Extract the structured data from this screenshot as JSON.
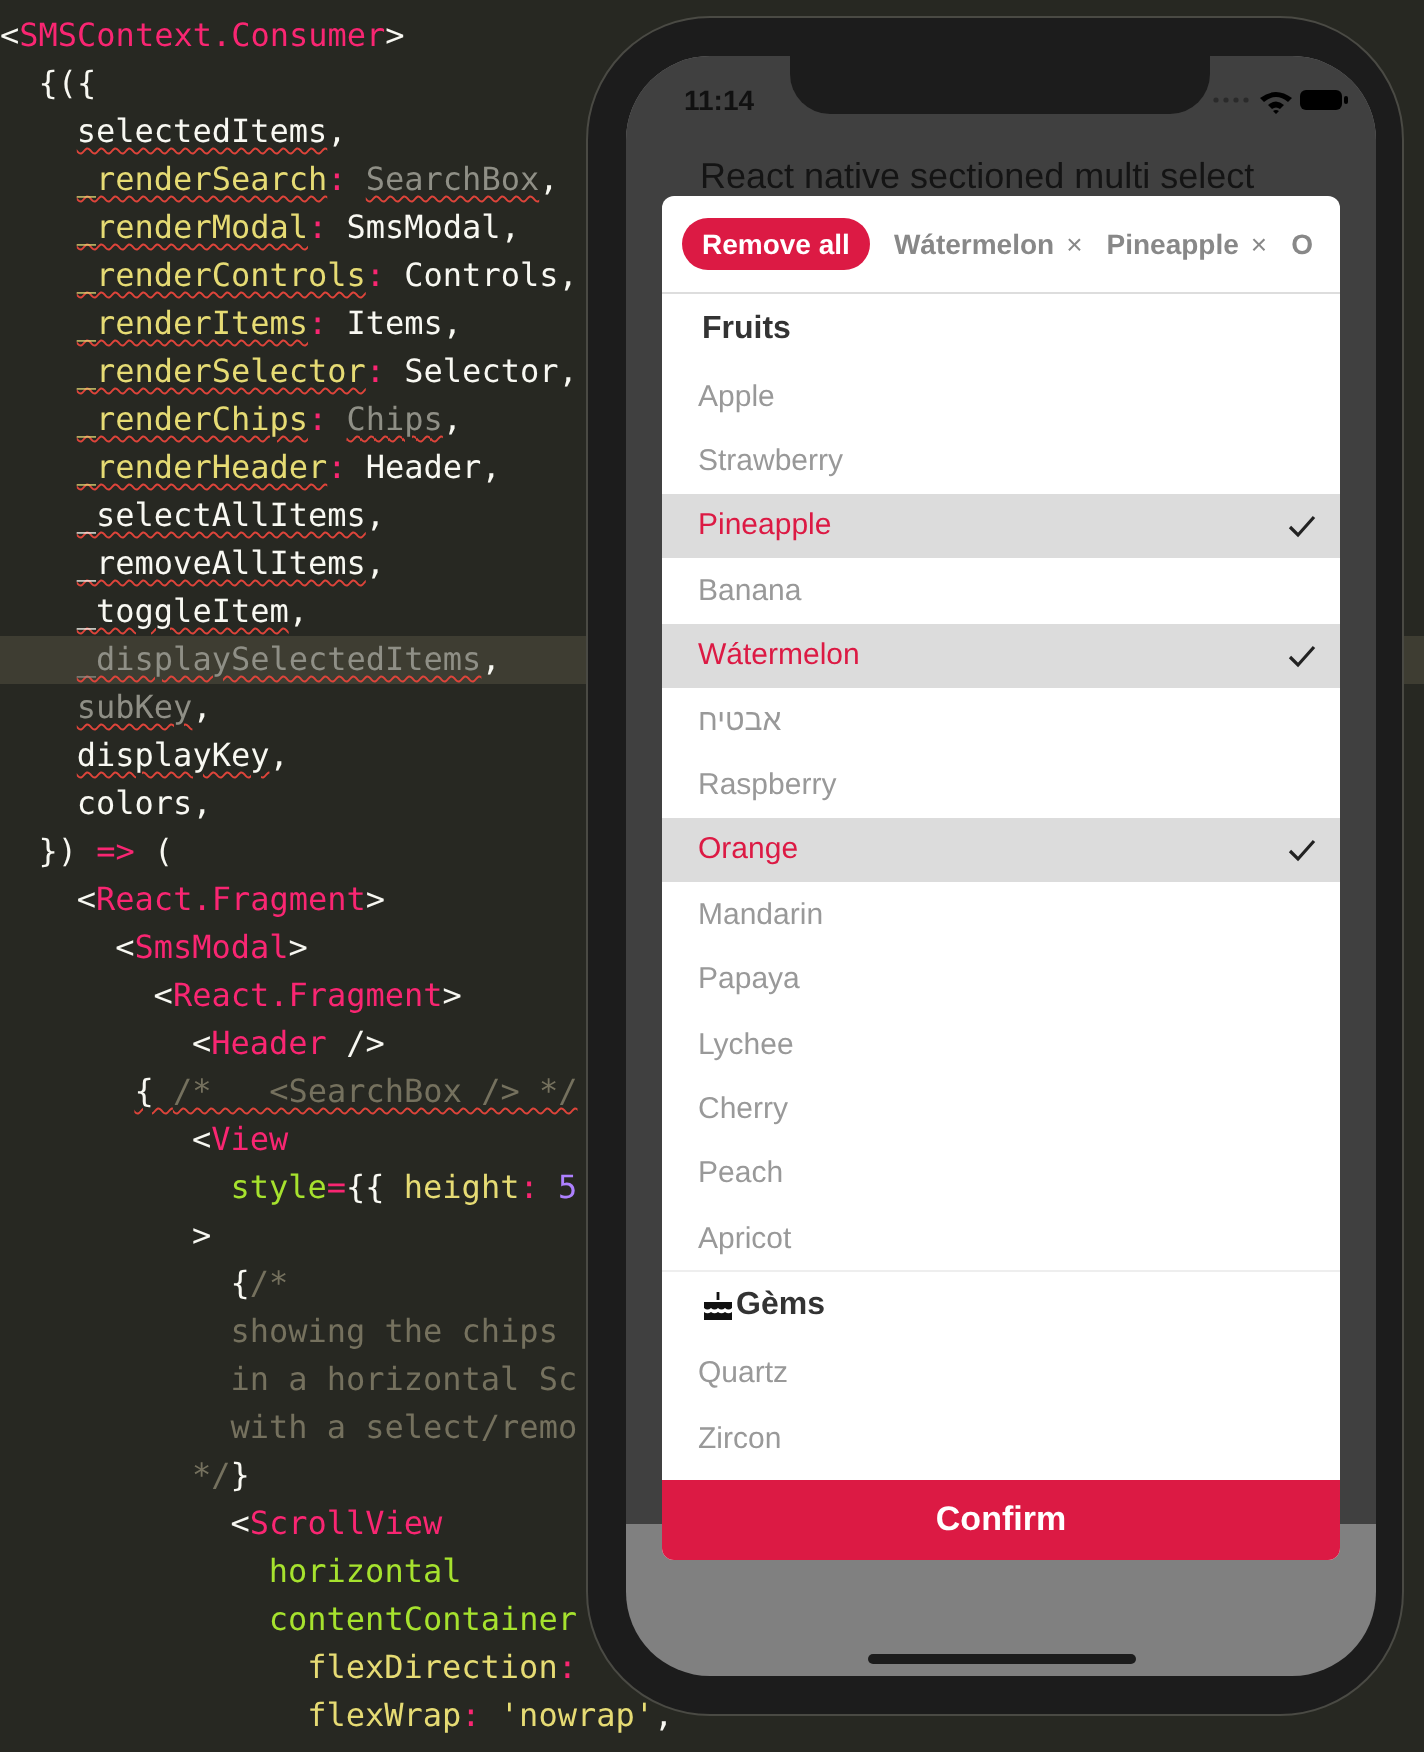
{
  "editor": {
    "lines": [
      {
        "highlighted": false,
        "tokens": [
          {
            "kind": "punct",
            "text": "<",
            "squiggly": false
          },
          {
            "kind": "tag",
            "text": "SMSContext.Consumer",
            "squiggly": false
          },
          {
            "kind": "punct",
            "text": ">",
            "squiggly": false
          }
        ]
      },
      {
        "highlighted": false,
        "tokens": [
          {
            "kind": "punct",
            "text": "{({",
            "squiggly": false
          }
        ]
      },
      {
        "highlighted": false,
        "tokens": [
          {
            "kind": "plain",
            "text": "selectedItems",
            "squiggly": true
          },
          {
            "kind": "punct",
            "text": ",",
            "squiggly": false
          }
        ]
      },
      {
        "highlighted": false,
        "tokens": [
          {
            "kind": "prop",
            "text": "_renderSearch",
            "squiggly": true
          },
          {
            "kind": "operator",
            "text": ": ",
            "squiggly": false
          },
          {
            "kind": "dim",
            "text": "SearchBox",
            "squiggly": true
          },
          {
            "kind": "punct",
            "text": ",",
            "squiggly": false
          }
        ]
      },
      {
        "highlighted": false,
        "tokens": [
          {
            "kind": "prop",
            "text": "_renderModal",
            "squiggly": true
          },
          {
            "kind": "operator",
            "text": ": ",
            "squiggly": false
          },
          {
            "kind": "plain",
            "text": "SmsModal,",
            "squiggly": false
          }
        ]
      },
      {
        "highlighted": false,
        "tokens": [
          {
            "kind": "prop",
            "text": "_renderControls",
            "squiggly": true
          },
          {
            "kind": "operator",
            "text": ": ",
            "squiggly": false
          },
          {
            "kind": "plain",
            "text": "Controls,",
            "squiggly": false
          }
        ]
      },
      {
        "highlighted": false,
        "tokens": [
          {
            "kind": "prop",
            "text": "_renderItems",
            "squiggly": true
          },
          {
            "kind": "operator",
            "text": ": ",
            "squiggly": false
          },
          {
            "kind": "plain",
            "text": "Items,",
            "squiggly": false
          }
        ]
      },
      {
        "highlighted": false,
        "tokens": [
          {
            "kind": "prop",
            "text": "_renderSelector",
            "squiggly": true
          },
          {
            "kind": "operator",
            "text": ": ",
            "squiggly": false
          },
          {
            "kind": "plain",
            "text": "Selector,",
            "squiggly": false
          }
        ]
      },
      {
        "highlighted": false,
        "tokens": [
          {
            "kind": "prop",
            "text": "_renderChips",
            "squiggly": true
          },
          {
            "kind": "operator",
            "text": ": ",
            "squiggly": false
          },
          {
            "kind": "dim",
            "text": "Chips",
            "squiggly": true
          },
          {
            "kind": "punct",
            "text": ",",
            "squiggly": false
          }
        ]
      },
      {
        "highlighted": false,
        "tokens": [
          {
            "kind": "prop",
            "text": "_renderHeader",
            "squiggly": true
          },
          {
            "kind": "operator",
            "text": ": ",
            "squiggly": false
          },
          {
            "kind": "plain",
            "text": "Header,",
            "squiggly": false
          }
        ]
      },
      {
        "highlighted": false,
        "tokens": [
          {
            "kind": "plain",
            "text": "_selectAllItems",
            "squiggly": true
          },
          {
            "kind": "punct",
            "text": ",",
            "squiggly": false
          }
        ]
      },
      {
        "highlighted": false,
        "tokens": [
          {
            "kind": "plain",
            "text": "_removeAllItems",
            "squiggly": true
          },
          {
            "kind": "punct",
            "text": ",",
            "squiggly": false
          }
        ]
      },
      {
        "highlighted": false,
        "tokens": [
          {
            "kind": "plain",
            "text": "_toggleItem",
            "squiggly": true
          },
          {
            "kind": "punct",
            "text": ",",
            "squiggly": false
          }
        ]
      },
      {
        "highlighted": true,
        "tokens": [
          {
            "kind": "dim",
            "text": "_displaySelectedItems",
            "squiggly": true
          },
          {
            "kind": "punct",
            "text": ",",
            "squiggly": false
          }
        ]
      },
      {
        "highlighted": false,
        "tokens": [
          {
            "kind": "dim",
            "text": "subKey",
            "squiggly": true
          },
          {
            "kind": "punct",
            "text": ",",
            "squiggly": false
          }
        ]
      },
      {
        "highlighted": false,
        "tokens": [
          {
            "kind": "plain",
            "text": "displayKey",
            "squiggly": true
          },
          {
            "kind": "punct",
            "text": ",",
            "squiggly": false
          }
        ]
      },
      {
        "highlighted": false,
        "tokens": [
          {
            "kind": "plain",
            "text": "colors,",
            "squiggly": false
          }
        ]
      },
      {
        "highlighted": false,
        "tokens": [
          {
            "kind": "punct",
            "text": "}) ",
            "squiggly": false
          },
          {
            "kind": "operator",
            "text": "=>",
            "squiggly": false
          },
          {
            "kind": "punct",
            "text": " (",
            "squiggly": false
          }
        ]
      },
      {
        "highlighted": false,
        "tokens": [
          {
            "kind": "punct",
            "text": "<",
            "squiggly": false
          },
          {
            "kind": "tag",
            "text": "React.Fragment",
            "squiggly": false
          },
          {
            "kind": "punct",
            "text": ">",
            "squiggly": false
          }
        ]
      },
      {
        "highlighted": false,
        "tokens": [
          {
            "kind": "punct",
            "text": "<",
            "squiggly": false
          },
          {
            "kind": "tag",
            "text": "SmsModal",
            "squiggly": false
          },
          {
            "kind": "punct",
            "text": ">",
            "squiggly": false
          }
        ]
      },
      {
        "highlighted": false,
        "tokens": [
          {
            "kind": "punct",
            "text": "<",
            "squiggly": false
          },
          {
            "kind": "tag",
            "text": "React.Fragment",
            "squiggly": false
          },
          {
            "kind": "punct",
            "text": ">",
            "squiggly": false
          }
        ]
      },
      {
        "highlighted": false,
        "tokens": [
          {
            "kind": "punct",
            "text": "<",
            "squiggly": false
          },
          {
            "kind": "tag",
            "text": "Header",
            "squiggly": false
          },
          {
            "kind": "punct",
            "text": " />",
            "squiggly": false
          }
        ]
      },
      {
        "highlighted": false,
        "tokens": [
          {
            "kind": "punct",
            "text": "{ ",
            "squiggly": true
          },
          {
            "kind": "comment",
            "text": "/*   <SearchBox /> */",
            "squiggly": true
          }
        ]
      },
      {
        "highlighted": false,
        "tokens": [
          {
            "kind": "punct",
            "text": "<",
            "squiggly": false
          },
          {
            "kind": "tag",
            "text": "View",
            "squiggly": false
          }
        ]
      },
      {
        "highlighted": false,
        "tokens": [
          {
            "kind": "attr",
            "text": "style",
            "squiggly": false
          },
          {
            "kind": "operator",
            "text": "=",
            "squiggly": false
          },
          {
            "kind": "punct",
            "text": "{{ ",
            "squiggly": false
          },
          {
            "kind": "prop",
            "text": "height",
            "squiggly": false
          },
          {
            "kind": "operator",
            "text": ": ",
            "squiggly": false
          },
          {
            "kind": "number",
            "text": "5",
            "squiggly": false
          }
        ]
      },
      {
        "highlighted": false,
        "tokens": [
          {
            "kind": "punct",
            "text": ">",
            "squiggly": false
          }
        ]
      },
      {
        "highlighted": false,
        "tokens": [
          {
            "kind": "punct",
            "text": "{",
            "squiggly": false
          },
          {
            "kind": "comment",
            "text": "/*",
            "squiggly": false
          }
        ]
      },
      {
        "highlighted": false,
        "tokens": [
          {
            "kind": "comment",
            "text": "showing the chips",
            "squiggly": false
          }
        ]
      },
      {
        "highlighted": false,
        "tokens": [
          {
            "kind": "comment",
            "text": "in a horizontal Sc",
            "squiggly": false
          }
        ]
      },
      {
        "highlighted": false,
        "tokens": [
          {
            "kind": "comment",
            "text": "with a select/remo",
            "squiggly": false
          }
        ]
      },
      {
        "highlighted": false,
        "tokens": [
          {
            "kind": "comment",
            "text": "*/",
            "squiggly": false
          },
          {
            "kind": "punct",
            "text": "}",
            "squiggly": false
          }
        ]
      },
      {
        "highlighted": false,
        "tokens": [
          {
            "kind": "punct",
            "text": "<",
            "squiggly": false
          },
          {
            "kind": "tag",
            "text": "ScrollView",
            "squiggly": false
          }
        ]
      },
      {
        "highlighted": false,
        "tokens": [
          {
            "kind": "attr",
            "text": "horizontal",
            "squiggly": false
          }
        ]
      },
      {
        "highlighted": false,
        "tokens": [
          {
            "kind": "attr",
            "text": "contentContainer",
            "squiggly": false
          }
        ]
      },
      {
        "highlighted": false,
        "tokens": [
          {
            "kind": "prop",
            "text": "flexDirection",
            "squiggly": false
          },
          {
            "kind": "operator",
            "text": ":",
            "squiggly": false
          }
        ]
      },
      {
        "highlighted": false,
        "tokens": [
          {
            "kind": "prop",
            "text": "flexWrap",
            "squiggly": false
          },
          {
            "kind": "operator",
            "text": ": ",
            "squiggly": false
          },
          {
            "kind": "string",
            "text": "'nowrap'",
            "squiggly": false
          },
          {
            "kind": "punct",
            "text": ",",
            "squiggly": false
          }
        ]
      }
    ]
  },
  "phone": {
    "status_bar": {
      "time": "11:14"
    },
    "title": "React native sectioned multi select",
    "chips": [
      {
        "kind": "action",
        "label": "Remove all"
      },
      {
        "kind": "chip",
        "label": "Wátermelon",
        "remove": "×"
      },
      {
        "kind": "chip",
        "label": "Pineapple",
        "remove": "×"
      },
      {
        "kind": "partial",
        "label": "O"
      }
    ],
    "sections": [
      {
        "title": "Fruits",
        "icon": false,
        "items": [
          {
            "label": "Apple",
            "selected": false
          },
          {
            "label": "Strawberry",
            "selected": false
          },
          {
            "label": "Pineapple",
            "selected": true
          },
          {
            "label": "Banana",
            "selected": false
          },
          {
            "label": "Wátermelon",
            "selected": true
          },
          {
            "label": "אבטיח",
            "selected": false
          },
          {
            "label": "Raspberry",
            "selected": false
          },
          {
            "label": "Orange",
            "selected": true
          },
          {
            "label": "Mandarin",
            "selected": false
          },
          {
            "label": "Papaya",
            "selected": false
          },
          {
            "label": "Lychee",
            "selected": false
          },
          {
            "label": "Cherry",
            "selected": false
          },
          {
            "label": "Peach",
            "selected": false
          },
          {
            "label": "Apricot",
            "selected": false
          }
        ]
      },
      {
        "title": "Gèms",
        "icon": true,
        "items": [
          {
            "label": "Quartz",
            "selected": false
          },
          {
            "label": "Zircon",
            "selected": false
          }
        ]
      }
    ],
    "confirm": "Confirm"
  }
}
